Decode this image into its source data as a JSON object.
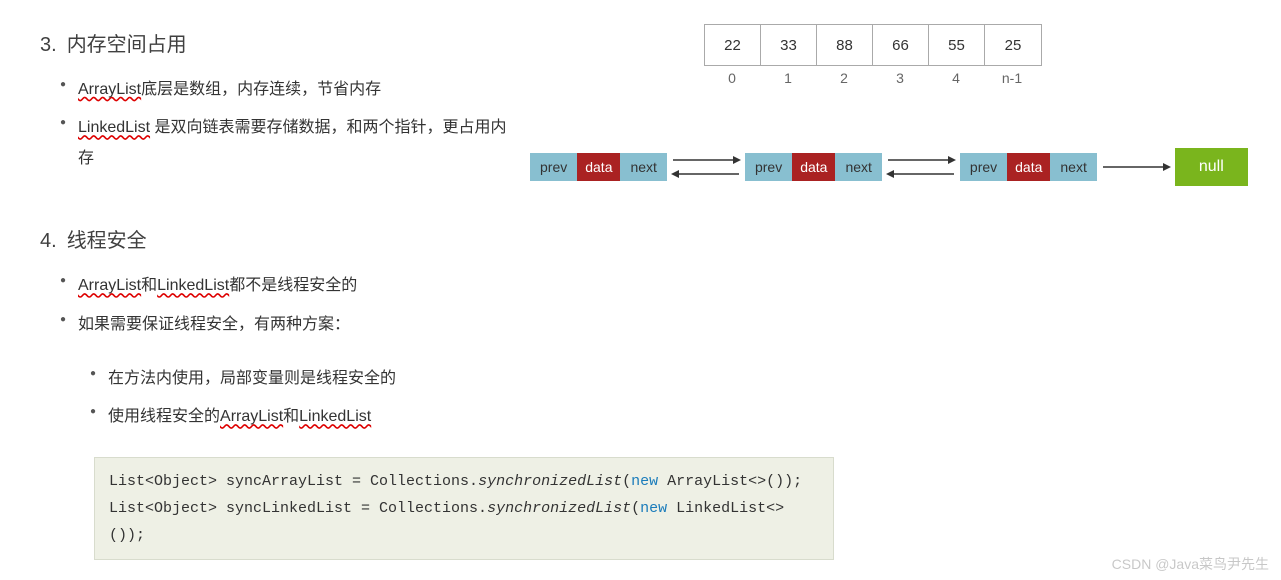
{
  "sections": {
    "s3": {
      "num": "3.",
      "title": "内存空间占用"
    },
    "s4": {
      "num": "4.",
      "title": "线程安全"
    }
  },
  "bullets3": {
    "b0_pre": "ArrayList",
    "b0_post": "底层是数组，内存连续，节省内存",
    "b1_pre": "LinkedList",
    "b1_post": " 是双向链表需要存储数据，和两个指针，更占用内存"
  },
  "bullets4": {
    "b0_a": "ArrayList",
    "b0_mid": "和",
    "b0_b": "LinkedList",
    "b0_post": "都不是线程安全的",
    "b1": "如果需要保证线程安全，有两种方案：",
    "sub0": "在方法内使用，局部变量则是线程安全的",
    "sub1_pre": "使用线程安全的",
    "sub1_a": "ArrayList",
    "sub1_mid": "和",
    "sub1_b": "LinkedList"
  },
  "array": {
    "values": [
      "22",
      "33",
      "88",
      "66",
      "55",
      "25"
    ],
    "indices": [
      "0",
      "1",
      "2",
      "3",
      "4",
      "n-1"
    ]
  },
  "node": {
    "prev": "prev",
    "data": "data",
    "next": "next"
  },
  "null_label": "null",
  "code": {
    "l1_a": "List<Object> syncArrayList = Collections.",
    "l1_b": "synchronizedList",
    "l1_c": "(",
    "l1_d": "new",
    "l1_e": " ArrayList<>());",
    "l2_a": "List<Object> syncLinkedList = Collections.",
    "l2_b": "synchronizedList",
    "l2_c": "(",
    "l2_d": "new",
    "l2_e": " LinkedList<>());"
  },
  "watermark": "CSDN @Java菜鸟尹先生"
}
